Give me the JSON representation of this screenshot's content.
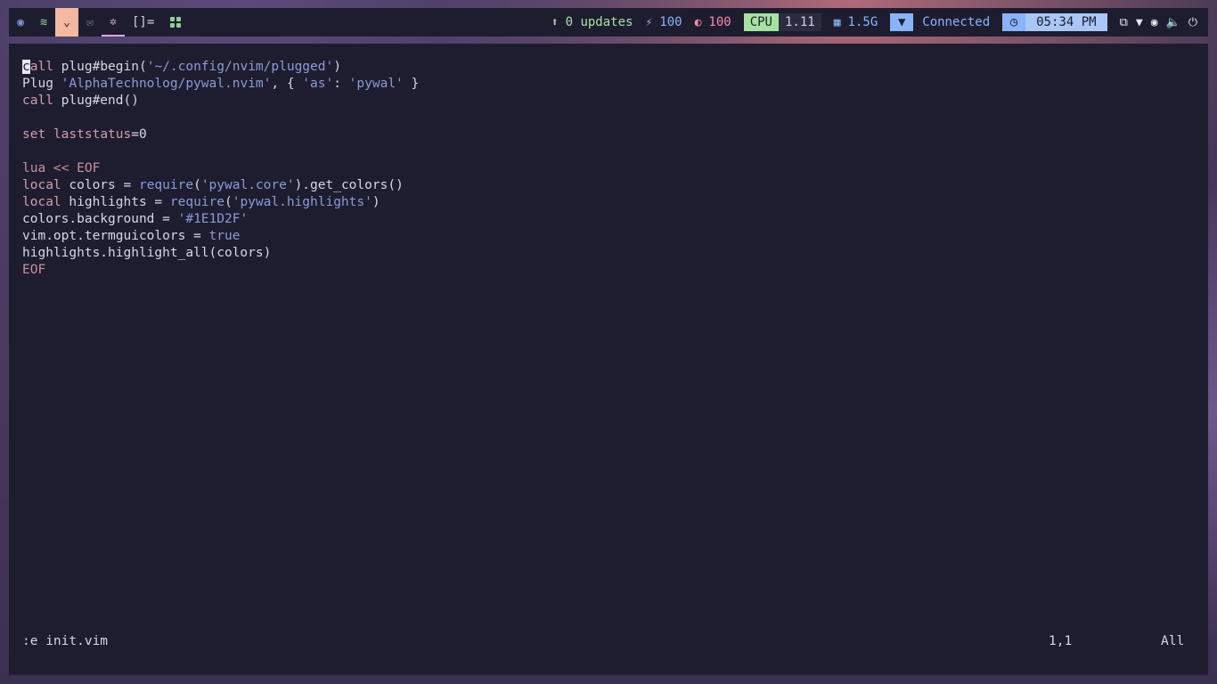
{
  "topbar": {
    "workspaces": [
      {
        "icon": "firefox-icon",
        "glyph": "◉"
      },
      {
        "icon": "spotify-icon",
        "glyph": "≋"
      },
      {
        "icon": "pocket-icon",
        "glyph": "⌄"
      },
      {
        "icon": "mail-icon",
        "glyph": "✉"
      },
      {
        "icon": "settings-icon",
        "glyph": "✲"
      }
    ],
    "layout_symbol": "[]=",
    "updates_text": "0 updates",
    "brightness_value": "100",
    "volume_value": "100",
    "cpu_label": "CPU",
    "cpu_value": "1.11",
    "mem_value": "1.5G",
    "network_status": "Connected",
    "time": "05:34 PM",
    "colors": {
      "bar_bg": "#1e1d2f",
      "active_ws": "#f4b8a0",
      "current_ws": "#e3a0e8",
      "updates": "#a6e3a1",
      "brightness": "#89b4fa",
      "volume": "#f38ba8",
      "cpu_bg": "#a6e3a1",
      "clock_bg": "#a9c6f5"
    }
  },
  "editor": {
    "lines": [
      [
        {
          "t": "c",
          "c": "cursor"
        },
        {
          "t": "all",
          "c": "kw"
        },
        {
          "t": " plug#begin(",
          "c": ""
        },
        {
          "t": "'~/.config/nvim/plugged'",
          "c": "str"
        },
        {
          "t": ")",
          "c": ""
        }
      ],
      [
        {
          "t": "Plug ",
          "c": ""
        },
        {
          "t": "'AlphaTechnolog/pywal.nvim'",
          "c": "str"
        },
        {
          "t": ", { ",
          "c": ""
        },
        {
          "t": "'as'",
          "c": "str"
        },
        {
          "t": ": ",
          "c": ""
        },
        {
          "t": "'pywal'",
          "c": "str"
        },
        {
          "t": " }",
          "c": ""
        }
      ],
      [
        {
          "t": "call",
          "c": "kw"
        },
        {
          "t": " plug#end()",
          "c": ""
        }
      ],
      [],
      [
        {
          "t": "set",
          "c": "kw"
        },
        {
          "t": " ",
          "c": ""
        },
        {
          "t": "laststatus",
          "c": "kw"
        },
        {
          "t": "=0",
          "c": ""
        }
      ],
      [],
      [
        {
          "t": "lua << EOF",
          "c": "op"
        }
      ],
      [
        {
          "t": "local",
          "c": "kw"
        },
        {
          "t": " colors = ",
          "c": ""
        },
        {
          "t": "require",
          "c": "str"
        },
        {
          "t": "(",
          "c": ""
        },
        {
          "t": "'pywal.core'",
          "c": "str"
        },
        {
          "t": ").get_colors()",
          "c": ""
        }
      ],
      [
        {
          "t": "local",
          "c": "kw"
        },
        {
          "t": " highlights = ",
          "c": ""
        },
        {
          "t": "require",
          "c": "str"
        },
        {
          "t": "(",
          "c": ""
        },
        {
          "t": "'pywal.highlights'",
          "c": "str"
        },
        {
          "t": ")",
          "c": ""
        }
      ],
      [
        {
          "t": "colors.background = ",
          "c": ""
        },
        {
          "t": "'#1E1D2F'",
          "c": "str"
        }
      ],
      [
        {
          "t": "vim.opt.termguicolors = ",
          "c": ""
        },
        {
          "t": "true",
          "c": "str"
        }
      ],
      [
        {
          "t": "highlights.highlight_all(colors)",
          "c": ""
        }
      ],
      [
        {
          "t": "EOF",
          "c": "op"
        }
      ]
    ],
    "command_line": ":e init.vim",
    "cursor_position": "1,1",
    "scroll_percent": "All"
  }
}
